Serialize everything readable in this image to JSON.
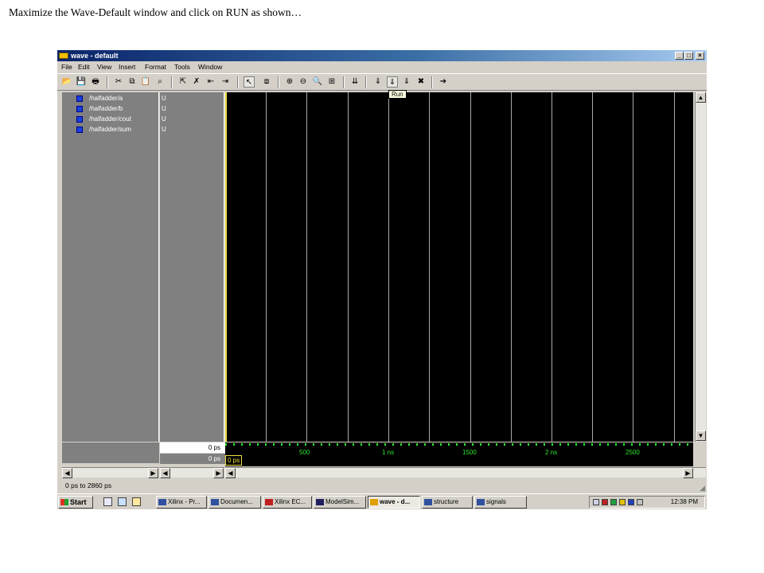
{
  "caption": "Maximize the Wave-Default window and click on RUN as shown…",
  "window": {
    "title": "wave - default",
    "buttons": {
      "minimize": "_",
      "maximize": "□",
      "close": "×"
    }
  },
  "menu": [
    "File",
    "Edit",
    "View",
    "Insert",
    "Format",
    "Tools",
    "Window"
  ],
  "tooltip": "Run",
  "signals": [
    {
      "name": "/halfadder/a",
      "value": "U"
    },
    {
      "name": "/halfadder/b",
      "value": "U"
    },
    {
      "name": "/halfadder/cout",
      "value": "U"
    },
    {
      "name": "/halfadder/sum",
      "value": "U"
    }
  ],
  "cursor_rows": [
    "0 ps",
    "0 ps"
  ],
  "timeline": {
    "labels": [
      "500",
      "1 ns",
      "1500",
      "2 ns",
      "2500"
    ],
    "cursor_label": "0 ps"
  },
  "status": "0 ps to 2860 ps",
  "taskbar": {
    "start": "Start",
    "tasks": [
      "Xilinx - Pr...",
      "Documen...",
      "Xilinx EC...",
      "ModelSim...",
      "wave - d...",
      "structure",
      "signals"
    ],
    "active_task": "wave - d...",
    "clock": "12:38 PM"
  },
  "colors": {
    "wave_bg": "#000000",
    "grid": "#c8c8c8",
    "cursor": "#f0e040",
    "timeline_text": "#2ee82e",
    "signal_icon": "#1840e0"
  }
}
